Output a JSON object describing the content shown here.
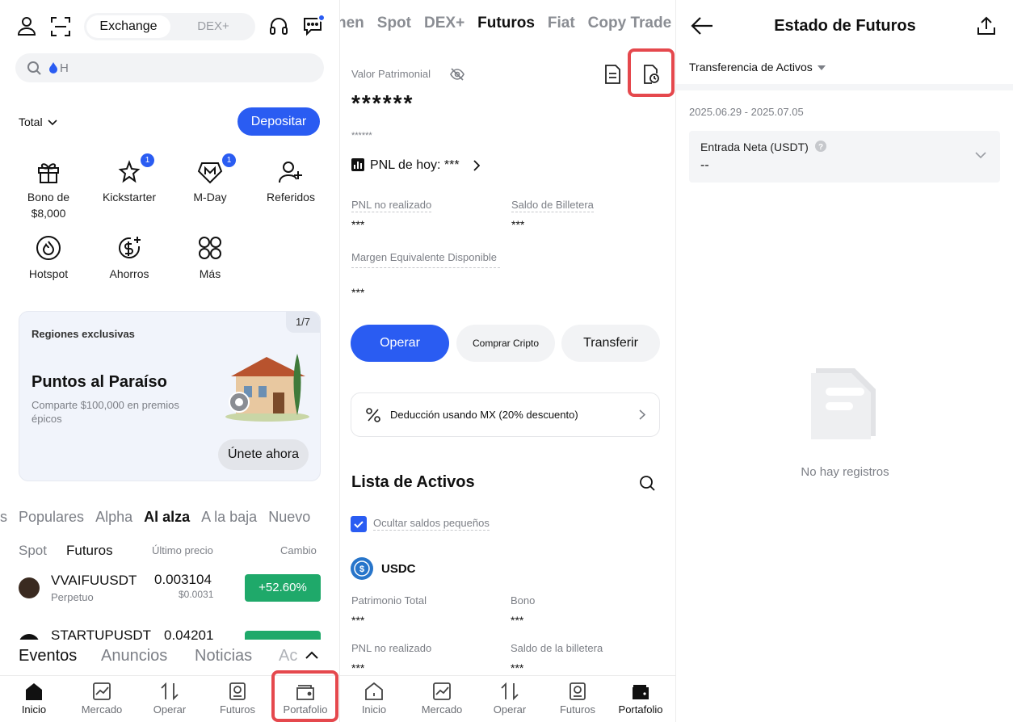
{
  "home": {
    "segment": {
      "exchange": "Exchange",
      "dex": "DEX+"
    },
    "search_placeholder": "H",
    "total_label": "Total",
    "deposit_label": "Depositar",
    "grid": [
      {
        "label": "Bono de $8,000",
        "icon": "gift-icon"
      },
      {
        "label": "Kickstarter",
        "icon": "rocket-icon",
        "badge": "1"
      },
      {
        "label": "M-Day",
        "icon": "m-day-icon",
        "badge": "1"
      },
      {
        "label": "Referidos",
        "icon": "add-user-icon"
      },
      {
        "label": "Hotspot",
        "icon": "flame-icon"
      },
      {
        "label": "Ahorros",
        "icon": "savings-icon"
      },
      {
        "label": "Más",
        "icon": "more-grid-icon"
      }
    ],
    "banner": {
      "counter": "1/7",
      "kicker": "Regiones exclusivas",
      "title": "Puntos al Paraíso",
      "subtitle": "Comparte $100,000 en premios épicos",
      "cta": "Únete ahora"
    },
    "market_tabs": [
      "s",
      "Populares",
      "Alpha",
      "Al alza",
      "A la baja",
      "Nuevo"
    ],
    "market_tab_active": "Al alza",
    "sub_tabs": {
      "spot": "Spot",
      "futures": "Futuros",
      "last_price": "Último precio",
      "change": "Cambio"
    },
    "rows": [
      {
        "symbol": "VVAIFUUSDT",
        "kind": "Perpetuo",
        "price": "0.003104",
        "usd": "$0.0031",
        "change": "+52.60%"
      },
      {
        "symbol": "STARTUPUSDT",
        "kind": "",
        "price": "0.04201",
        "usd": "",
        "change": ""
      }
    ],
    "news_tabs": [
      "Eventos",
      "Anuncios",
      "Noticias",
      "Ac"
    ],
    "nav": [
      {
        "label": "Inicio",
        "icon": "home-icon"
      },
      {
        "label": "Mercado",
        "icon": "chart-icon"
      },
      {
        "label": "Operar",
        "icon": "trade-arrows-icon"
      },
      {
        "label": "Futuros",
        "icon": "futures-icon"
      },
      {
        "label": "Portafolio",
        "icon": "wallet-icon"
      }
    ]
  },
  "portfolio": {
    "top_tabs": [
      "nen",
      "Spot",
      "DEX+",
      "Futuros",
      "Fiat",
      "Copy Trade"
    ],
    "top_tab_active": "Futuros",
    "equity_label": "Valor Patrimonial",
    "equity_value": "******",
    "equity_sub": "******",
    "pnl_today": "PNL de hoy: ***",
    "unrealized_label": "PNL no realizado",
    "unrealized_value": "***",
    "wallet_balance_label": "Saldo de Billetera",
    "wallet_balance_value": "***",
    "margin_label": "Margen Equivalente Disponible",
    "margin_value": "***",
    "actions": {
      "trade": "Operar",
      "buy": "Comprar Cripto",
      "transfer": "Transferir"
    },
    "deduction": "Deducción usando MX (20% descuento)",
    "asset_list_title": "Lista de Activos",
    "hide_small": "Ocultar saldos pequeños",
    "coin": "USDC",
    "coin_fields": [
      {
        "label": "Patrimonio Total",
        "value": "***"
      },
      {
        "label": "Bono",
        "value": "***"
      },
      {
        "label": "PNL no realizado",
        "value": "***"
      },
      {
        "label": "Saldo de la billetera",
        "value": "***"
      }
    ],
    "nav": [
      {
        "label": "Inicio",
        "icon": "home-icon"
      },
      {
        "label": "Mercado",
        "icon": "chart-icon"
      },
      {
        "label": "Operar",
        "icon": "trade-arrows-icon"
      },
      {
        "label": "Futuros",
        "icon": "futures-icon"
      },
      {
        "label": "Portafolio",
        "icon": "wallet-icon"
      }
    ]
  },
  "status": {
    "title": "Estado de Futuros",
    "filter": "Transferencia de Activos",
    "date_range": "2025.06.29 - 2025.07.05",
    "net_inflow_label": "Entrada Neta (USDT)",
    "net_inflow_value": "--",
    "empty": "No hay registros"
  },
  "colors": {
    "accent": "#2a5cf2",
    "up": "#1fa96a",
    "highlight": "#e5484d"
  }
}
